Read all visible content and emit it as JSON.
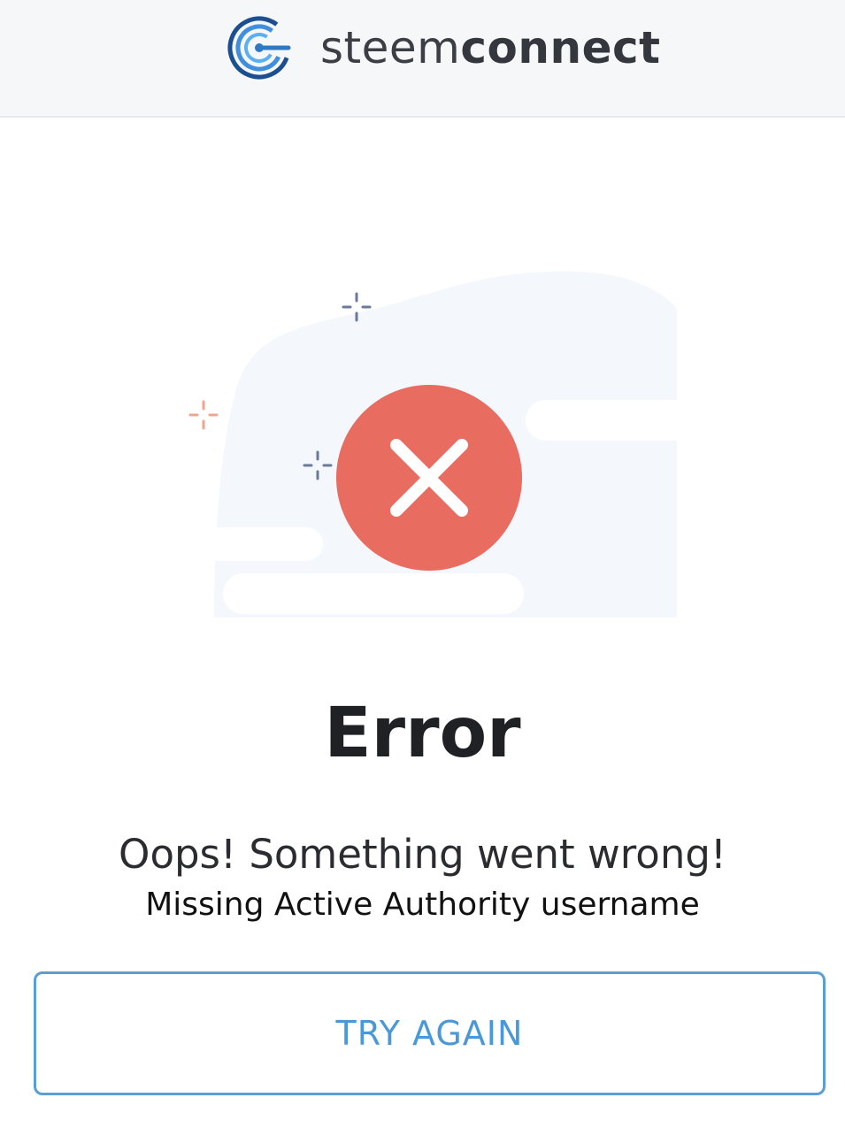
{
  "header": {
    "brand_light": "steem",
    "brand_bold": "connect",
    "logo_icon": "steemconnect-logo-icon"
  },
  "illustration": {
    "icon": "error-x-circle-icon",
    "accent_color": "#e86c60",
    "sparkle_colors": [
      "#6b7a99",
      "#f2a58a"
    ]
  },
  "main": {
    "title": "Error",
    "subtitle": "Oops! Something went wrong!",
    "detail": "Missing Active Authority username",
    "button_label": "TRY AGAIN"
  },
  "colors": {
    "header_bg": "#f6f7f9",
    "button_border": "#5a9ed6",
    "button_text": "#4a98d8"
  }
}
